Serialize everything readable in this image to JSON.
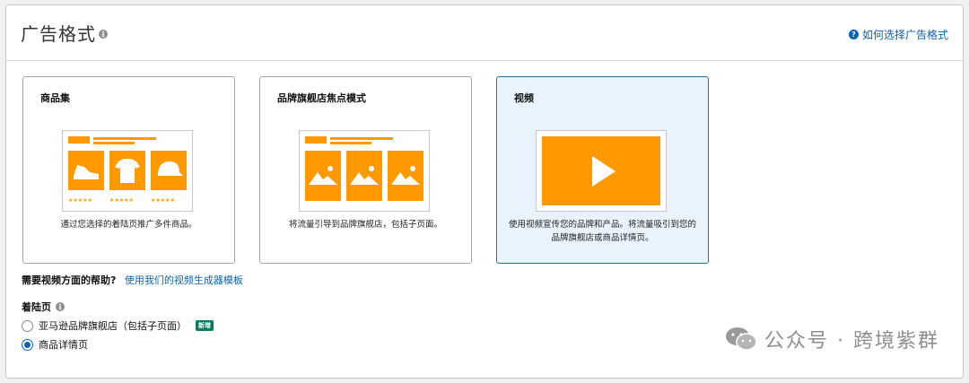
{
  "header": {
    "title": "广告格式",
    "help_link": "如何选择广告格式"
  },
  "cards": [
    {
      "title": "商品集",
      "description": "通过您选择的着陆页推广多件商品。",
      "selected": false
    },
    {
      "title": "品牌旗舰店焦点模式",
      "description": "将流量引导到品牌旗舰店，包括子页面。",
      "selected": false
    },
    {
      "title": "视频",
      "description": "使用视频宣传您的品牌和产品。将流量吸引到您的品牌旗舰店或商品详情页。",
      "selected": true
    }
  ],
  "video_help": {
    "question": "需要视频方面的帮助?",
    "link": "使用我们的视频生成器模板"
  },
  "landing": {
    "title": "着陆页",
    "options": [
      {
        "label": "亚马逊品牌旗舰店（包括子页面）",
        "badge": "新增",
        "checked": false
      },
      {
        "label": "商品详情页",
        "checked": true
      }
    ]
  },
  "watermark": {
    "text": "公众号 · 跨境紫群"
  },
  "colors": {
    "accent": "#ff9900",
    "link": "#0a62b5",
    "selected_bg": "#e9f3fd"
  }
}
